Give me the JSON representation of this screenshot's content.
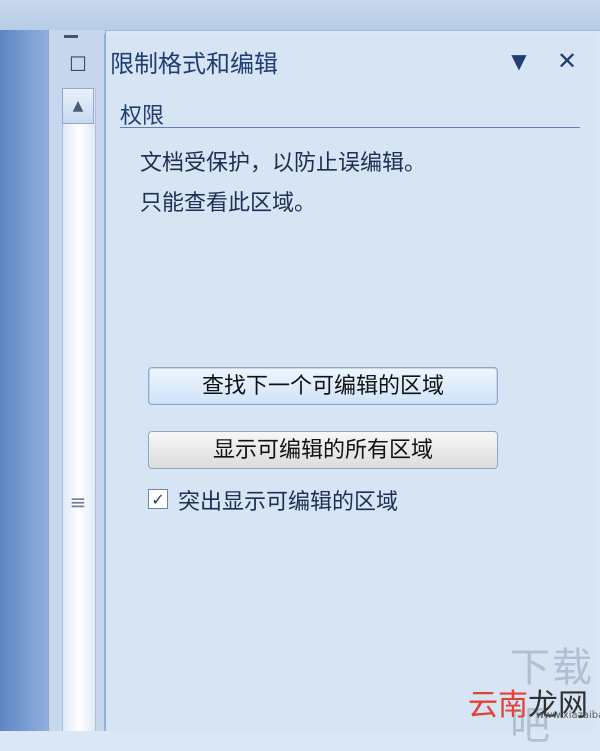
{
  "panel": {
    "title": "限制格式和编辑",
    "section": "权限",
    "info_lines": [
      "文档受保护，以防止误编辑。",
      "只能查看此区域。"
    ]
  },
  "buttons": {
    "find_next_editable": "查找下一个可编辑的区域",
    "show_all_editable": "显示可编辑的所有区域"
  },
  "checkbox": {
    "label": "突出显示可编辑的区域",
    "checked": true
  },
  "watermark": {
    "line1": "下载吧",
    "line2_red": "云南",
    "line2_dark": "龙网",
    "line3": "www.xiazaiba.com"
  }
}
